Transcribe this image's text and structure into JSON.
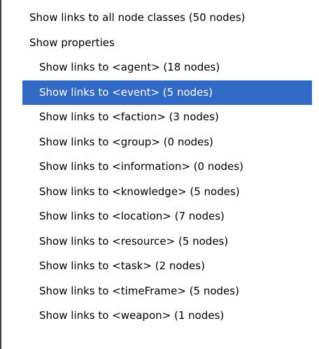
{
  "menu": {
    "items": [
      {
        "label": "Show links to all node classes (50 nodes)",
        "level": 0,
        "highlighted": false
      },
      {
        "label": "Show properties",
        "level": 0,
        "highlighted": false
      },
      {
        "label": "Show links to <agent>  (18 nodes)",
        "level": 1,
        "highlighted": false
      },
      {
        "label": "Show links to <event>  (5 nodes)",
        "level": 1,
        "highlighted": true
      },
      {
        "label": "Show links to <faction>  (3 nodes)",
        "level": 1,
        "highlighted": false
      },
      {
        "label": "Show links to <group>  (0 nodes)",
        "level": 1,
        "highlighted": false
      },
      {
        "label": "Show links to <information>  (0 nodes)",
        "level": 1,
        "highlighted": false
      },
      {
        "label": "Show links to <knowledge>  (5 nodes)",
        "level": 1,
        "highlighted": false
      },
      {
        "label": "Show links to <location>  (7 nodes)",
        "level": 1,
        "highlighted": false
      },
      {
        "label": "Show links to <resource>  (5 nodes)",
        "level": 1,
        "highlighted": false
      },
      {
        "label": "Show links to <task>  (2 nodes)",
        "level": 1,
        "highlighted": false
      },
      {
        "label": "Show links to <timeFrame>  (5 nodes)",
        "level": 1,
        "highlighted": false
      },
      {
        "label": "Show links to <weapon>  (1 nodes)",
        "level": 1,
        "highlighted": false
      }
    ]
  },
  "colors": {
    "highlight_background": "#316ac5",
    "highlight_text": "#ffffff",
    "menu_background": "#ffffff",
    "border": "#404040"
  }
}
